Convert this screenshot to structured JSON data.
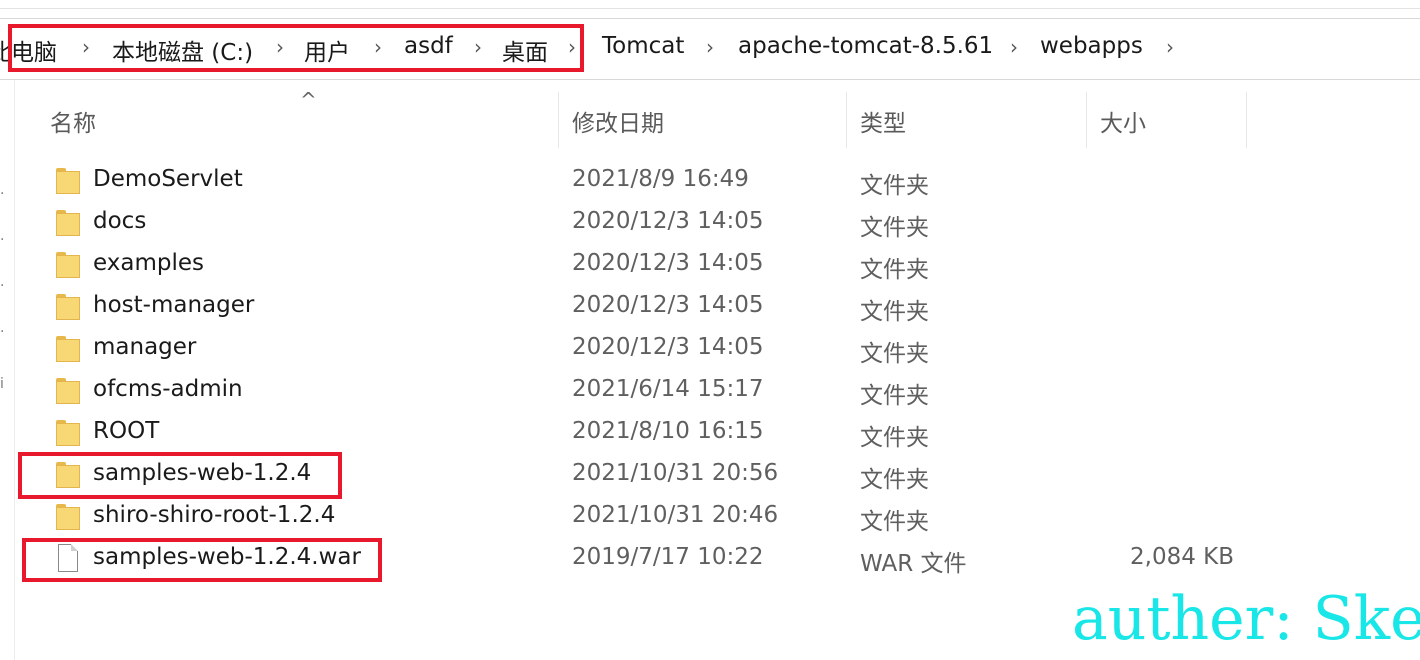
{
  "breadcrumb": {
    "items": [
      "此电脑",
      "本地磁盘 (C:)",
      "用户",
      "asdf",
      "桌面",
      "Tomcat",
      "apache-tomcat-8.5.61",
      "webapps"
    ],
    "separator": "›"
  },
  "columns": {
    "name": "名称",
    "date": "修改日期",
    "type": "类型",
    "size": "大小",
    "sort_indicator": "^"
  },
  "files": [
    {
      "name": "DemoServlet",
      "date": "2021/8/9 16:49",
      "type": "文件夹",
      "size": "",
      "icon": "folder-icon"
    },
    {
      "name": "docs",
      "date": "2020/12/3 14:05",
      "type": "文件夹",
      "size": "",
      "icon": "folder-icon"
    },
    {
      "name": "examples",
      "date": "2020/12/3 14:05",
      "type": "文件夹",
      "size": "",
      "icon": "folder-icon"
    },
    {
      "name": "host-manager",
      "date": "2020/12/3 14:05",
      "type": "文件夹",
      "size": "",
      "icon": "folder-icon"
    },
    {
      "name": "manager",
      "date": "2020/12/3 14:05",
      "type": "文件夹",
      "size": "",
      "icon": "folder-icon"
    },
    {
      "name": "ofcms-admin",
      "date": "2021/6/14 15:17",
      "type": "文件夹",
      "size": "",
      "icon": "folder-icon"
    },
    {
      "name": "ROOT",
      "date": "2021/8/10 16:15",
      "type": "文件夹",
      "size": "",
      "icon": "folder-icon"
    },
    {
      "name": "samples-web-1.2.4",
      "date": "2021/10/31 20:56",
      "type": "文件夹",
      "size": "",
      "icon": "folder-icon"
    },
    {
      "name": "shiro-shiro-root-1.2.4",
      "date": "2021/10/31 20:46",
      "type": "文件夹",
      "size": "",
      "icon": "folder-icon"
    },
    {
      "name": "samples-web-1.2.4.war",
      "date": "2019/7/17 10:22",
      "type": "WAR 文件",
      "size": "2,084 KB",
      "icon": "file-icon"
    }
  ],
  "watermark": "auther: Ske",
  "colors": {
    "highlight_box": "#e8192c",
    "watermark": "#19e6e6",
    "folder": "#f8d775"
  }
}
